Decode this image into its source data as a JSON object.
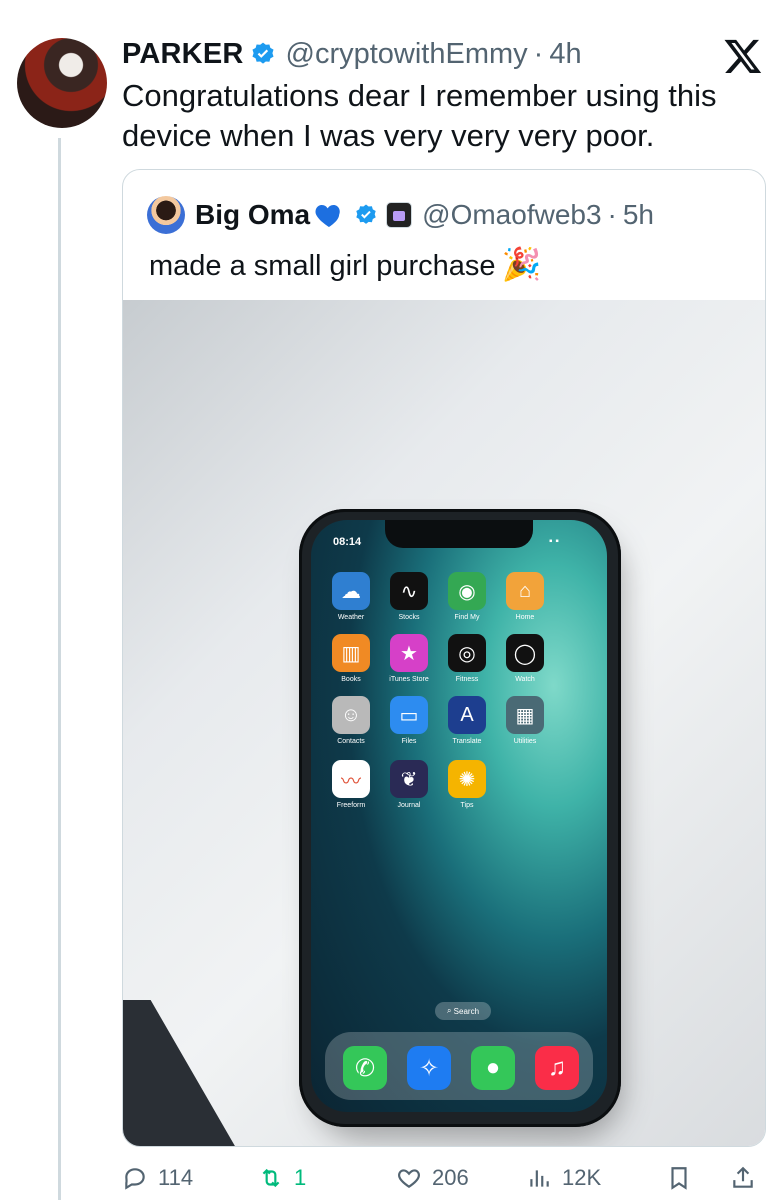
{
  "post": {
    "author_name": "PARKER",
    "handle": "@cryptowithEmmy",
    "separator": "·",
    "time": "4h",
    "text": "Congratulations dear I remember using this device when I was very very very poor."
  },
  "quoted": {
    "author_name": "Big Oma",
    "handle": "@Omaofweb3",
    "separator": "·",
    "time": "5h",
    "text": "made a small girl purchase",
    "emoji": "🎉",
    "phone_screen": {
      "time": "08:14",
      "apps": [
        {
          "label": "Weather",
          "icon": "weather-icon",
          "color": "#2f7fd1",
          "glyph": "☁"
        },
        {
          "label": "Stocks",
          "icon": "stocks-icon",
          "color": "#111111",
          "glyph": "∿"
        },
        {
          "label": "Find My",
          "icon": "find-my-icon",
          "color": "#34a853",
          "glyph": "◉"
        },
        {
          "label": "Home",
          "icon": "home-icon",
          "color": "#f2a33a",
          "glyph": "⌂"
        },
        {
          "label": "Books",
          "icon": "books-icon",
          "color": "#f08a24",
          "glyph": "▥"
        },
        {
          "label": "iTunes Store",
          "icon": "itunes-store-icon",
          "color": "#d640c8",
          "glyph": "★"
        },
        {
          "label": "Fitness",
          "icon": "fitness-icon",
          "color": "#111111",
          "glyph": "◎"
        },
        {
          "label": "Watch",
          "icon": "watch-icon",
          "color": "#111111",
          "glyph": "◯"
        },
        {
          "label": "Contacts",
          "icon": "contacts-icon",
          "color": "#b9b9b9",
          "glyph": "☺"
        },
        {
          "label": "Files",
          "icon": "files-icon",
          "color": "#2d8cf0",
          "glyph": "▭"
        },
        {
          "label": "Translate",
          "icon": "translate-icon",
          "color": "#1d3e8f",
          "glyph": "A"
        },
        {
          "label": "Utilities",
          "icon": "utilities-icon",
          "color": "#4a6a75",
          "glyph": "▦"
        },
        {
          "label": "Freeform",
          "icon": "freeform-icon",
          "color": "#ffffff",
          "glyph": "〰"
        },
        {
          "label": "Journal",
          "icon": "journal-icon",
          "color": "#2a2a55",
          "glyph": "❦"
        },
        {
          "label": "Tips",
          "icon": "tips-icon",
          "color": "#f5b400",
          "glyph": "✺"
        }
      ],
      "search_label": "Search",
      "dock": [
        {
          "name": "phone-app-icon",
          "color": "#34c759",
          "glyph": "✆"
        },
        {
          "name": "safari-icon",
          "color": "#1e7cf2",
          "glyph": "✧"
        },
        {
          "name": "messages-icon",
          "color": "#34c759",
          "glyph": "●"
        },
        {
          "name": "music-icon",
          "color": "#fa2d48",
          "glyph": "♫"
        }
      ]
    }
  },
  "actions": {
    "replies": "114",
    "reposts": "1",
    "likes": "206",
    "views": "12K"
  },
  "colors": {
    "verified": "#1d9bf0",
    "repost_active": "#00ba7c",
    "muted": "#536471"
  }
}
